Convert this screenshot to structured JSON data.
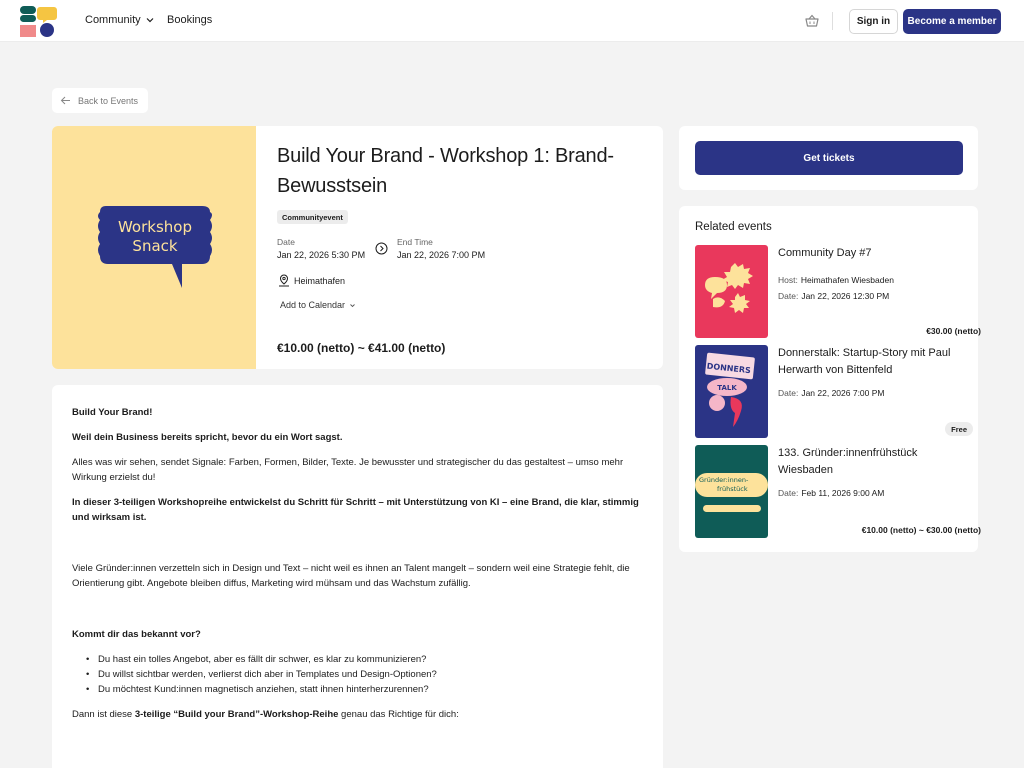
{
  "header": {
    "logo": "brand-logo",
    "nav": {
      "community": "Community",
      "bookings": "Bookings"
    },
    "sign_in": "Sign in",
    "become_member": "Become a member"
  },
  "back_label": "Back to Events",
  "event": {
    "title": "Build Your Brand - Workshop 1: Brand-Bewusstsein",
    "image_text_line1": "Workshop",
    "image_text_line2": "Snack",
    "category": "Communityevent",
    "date_label": "Date",
    "date_value": "Jan 22, 2026 5:30 PM",
    "end_label": "End Time",
    "end_value": "Jan 22, 2026 7:00 PM",
    "location": "Heimathafen",
    "add_calendar": "Add to Calendar",
    "price": "€10.00 (netto) ~ €41.00 (netto)"
  },
  "description": {
    "p1": "Build Your Brand!",
    "p2": "Weil dein Business bereits spricht, bevor du ein Wort sagst.",
    "p3": "Alles was wir sehen, sendet Signale: Farben, Formen, Bilder, Texte. Je bewusster und strategischer du das gestaltest – umso mehr Wirkung erzielst du!",
    "p4": "In dieser 3-teiligen Workshopreihe entwickelst du Schritt für Schritt – mit Unterstützung von KI – eine Brand, die klar, stimmig und wirksam ist.",
    "p5": "Viele Gründer:innen verzetteln sich in Design und Text – nicht weil es ihnen an Talent mangelt – sondern weil eine Strategie fehlt, die Orientierung gibt. Angebote bleiben diffus, Marketing wird mühsam und das Wachstum zufällig.",
    "p6": "Kommt dir das bekannt vor?",
    "bullets": [
      "Du hast ein tolles Angebot, aber es fällt dir schwer, es klar zu kommunizieren?",
      "Du willst sichtbar werden, verlierst dich aber in Templates und Design-Optionen?",
      "Du möchtest Kund:innen magnetisch anziehen, statt ihnen hinterherzurennen?"
    ],
    "p7_pre": "Dann ist diese ",
    "p7_bold": "3-teilige “Build your Brand”-Workshop-Reihe",
    "p7_post": " genau das Richtige für dich:"
  },
  "tickets_button": "Get tickets",
  "related": {
    "title": "Related events",
    "items": [
      {
        "name": "Community Day #7",
        "host_label": "Host:",
        "host": "Heimathafen Wiesbaden",
        "date_label": "Date:",
        "date": "Jan 22, 2026 12:30 PM",
        "price": "€30.00 (netto)"
      },
      {
        "name": "Donnerstalk: Startup-Story mit Paul Herwarth von Bittenfeld",
        "date_label": "Date:",
        "date": "Jan 22, 2026 7:00 PM",
        "price": "Free",
        "thumb_text1": "DONNERS",
        "thumb_text2": "TALK"
      },
      {
        "name": "133. Gründer:innenfrühstück Wiesbaden",
        "date_label": "Date:",
        "date": "Feb 11, 2026 9:00 AM",
        "price": "€10.00 (netto) ~ €30.00 (netto)",
        "thumb_text1": "Gründer:innen-",
        "thumb_text2": "frühstück"
      }
    ]
  },
  "colors": {
    "primary": "#2b3486",
    "event_image_bg": "#fde29b",
    "related1_bg": "#e9385c",
    "related2_bg": "#2b3486",
    "related3_bg": "#0f5c57"
  }
}
